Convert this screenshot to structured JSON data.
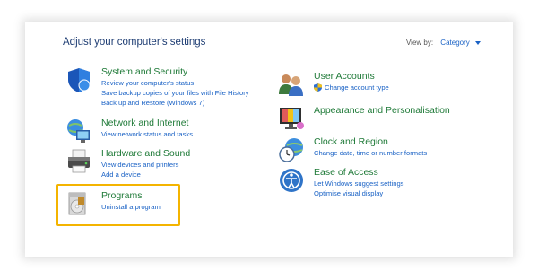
{
  "header": {
    "title": "Adjust your computer's settings",
    "view_by_label": "View by:",
    "view_by_value": "Category"
  },
  "left_categories": [
    {
      "title": "System and Security",
      "icon": "shield-icon",
      "links": [
        "Review your computer's status",
        "Save backup copies of your files with File History",
        "Back up and Restore (Windows 7)"
      ]
    },
    {
      "title": "Network and Internet",
      "icon": "globe-network-icon",
      "links": [
        "View network status and tasks"
      ]
    },
    {
      "title": "Hardware and Sound",
      "icon": "printer-icon",
      "links": [
        "View devices and printers",
        "Add a device"
      ]
    },
    {
      "title": "Programs",
      "icon": "programs-disc-icon",
      "links": [
        "Uninstall a program"
      ]
    }
  ],
  "right_categories": [
    {
      "title": "User Accounts",
      "icon": "users-icon",
      "links": [
        "Change account type"
      ]
    },
    {
      "title": "Appearance and Personalisation",
      "icon": "monitor-palette-icon",
      "links": []
    },
    {
      "title": "Clock and Region",
      "icon": "clock-globe-icon",
      "links": [
        "Change date, time or number formats"
      ]
    },
    {
      "title": "Ease of Access",
      "icon": "ease-of-access-icon",
      "links": [
        "Let Windows suggest settings",
        "Optimise visual display"
      ]
    }
  ],
  "colors": {
    "heading_green": "#1f7a38",
    "link_blue": "#1a62c5",
    "title_navy": "#1e3d73",
    "highlight": "#f4b400"
  }
}
